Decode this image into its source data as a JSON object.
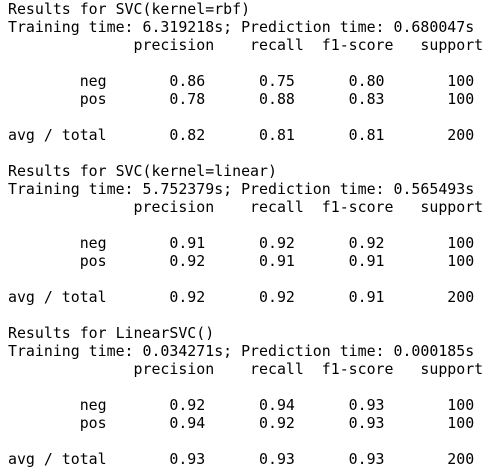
{
  "blocks": [
    {
      "results": "Results for SVC(kernel=rbf)",
      "timing": "Training time: 6.319218s; Prediction time: 0.680047s",
      "header": "              precision    recall  f1-score   support",
      "neg": "        neg       0.86      0.75      0.80       100",
      "pos": "        pos       0.78      0.88      0.83       100",
      "avg": "avg / total       0.82      0.81      0.81       200"
    },
    {
      "results": "Results for SVC(kernel=linear)",
      "timing": "Training time: 5.752379s; Prediction time: 0.565493s",
      "header": "              precision    recall  f1-score   support",
      "neg": "        neg       0.91      0.92      0.92       100",
      "pos": "        pos       0.92      0.91      0.91       100",
      "avg": "avg / total       0.92      0.92      0.91       200"
    },
    {
      "results": "Results for LinearSVC()",
      "timing": "Training time: 0.034271s; Prediction time: 0.000185s",
      "header": "              precision    recall  f1-score   support",
      "neg": "        neg       0.92      0.94      0.93       100",
      "pos": "        pos       0.94      0.92      0.93       100",
      "avg": "avg / total       0.93      0.93      0.93       200"
    }
  ]
}
